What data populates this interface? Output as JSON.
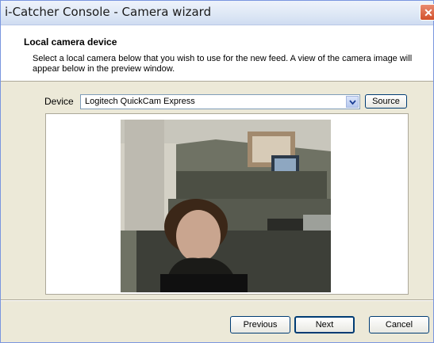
{
  "window": {
    "title": "i-Catcher Console - Camera wizard",
    "close_icon": "close-icon"
  },
  "header": {
    "title": "Local camera device",
    "description": "Select a local camera below that you wish to use for the new feed. A view of the camera image will appear below in the preview window."
  },
  "device": {
    "label": "Device",
    "selected": "Logitech QuickCam Express",
    "source_label": "Source"
  },
  "preview": {
    "image": "webcam preview of office with woman at desk"
  },
  "footer": {
    "previous_label": "Previous",
    "next_label": "Next",
    "cancel_label": "Cancel"
  }
}
